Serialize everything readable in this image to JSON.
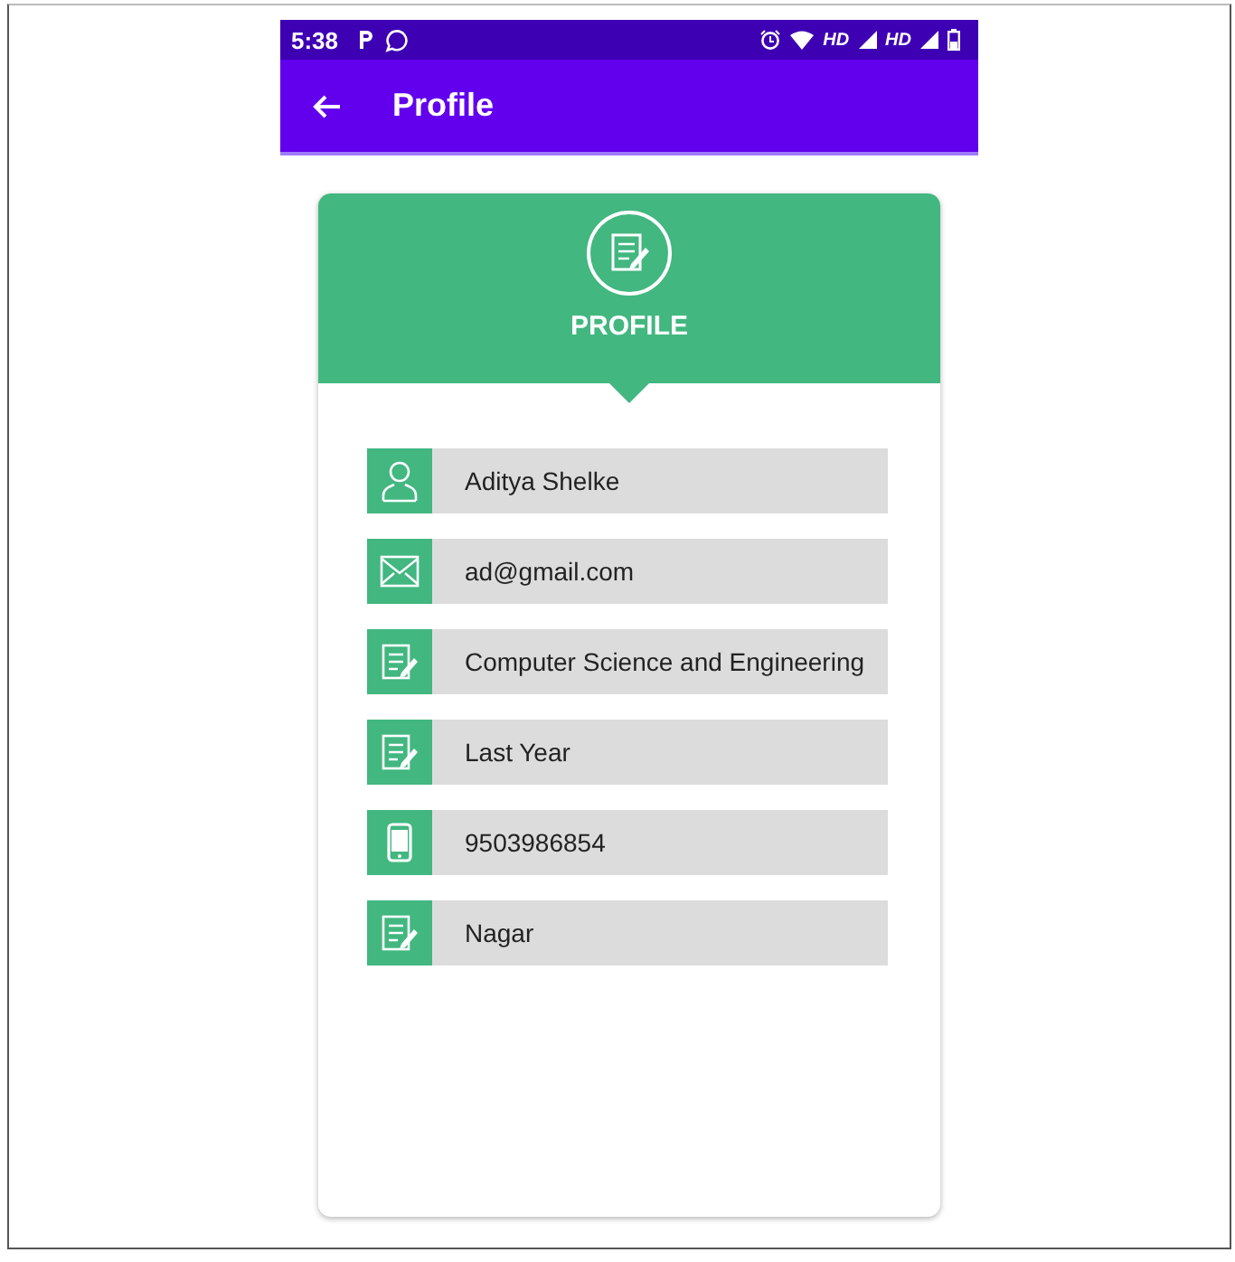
{
  "status_bar": {
    "time": "5:38",
    "network_labels": [
      "HD",
      "HD"
    ]
  },
  "app_bar": {
    "title": "Profile"
  },
  "card": {
    "title": "PROFILE"
  },
  "fields": [
    {
      "kind": "person",
      "value": "Aditya Shelke"
    },
    {
      "kind": "mail",
      "value": "ad@gmail.com"
    },
    {
      "kind": "note",
      "value": "Computer Science and Engineering"
    },
    {
      "kind": "note",
      "value": "Last Year"
    },
    {
      "kind": "phone",
      "value": "9503986854"
    },
    {
      "kind": "note",
      "value": "Nagar"
    }
  ]
}
